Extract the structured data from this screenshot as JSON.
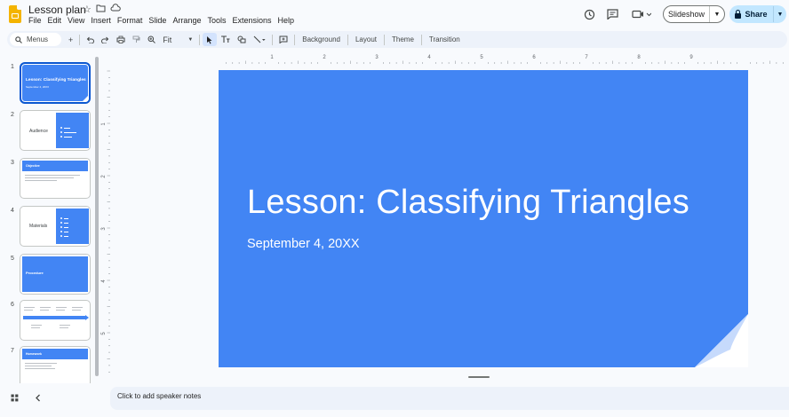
{
  "app": {
    "doc_title": "Lesson plan",
    "menu": [
      "File",
      "Edit",
      "View",
      "Insert",
      "Format",
      "Slide",
      "Arrange",
      "Tools",
      "Extensions",
      "Help"
    ],
    "slideshow_label": "Slideshow",
    "share_label": "Share"
  },
  "toolbar": {
    "search_label": "Menus",
    "zoom_label": "Fit",
    "background_label": "Background",
    "layout_label": "Layout",
    "theme_label": "Theme",
    "transition_label": "Transition"
  },
  "ruler": {
    "top_numbers": [
      "1",
      "2",
      "3",
      "4",
      "5",
      "6",
      "7",
      "8",
      "9"
    ],
    "left_numbers": [
      "1",
      "2",
      "3",
      "4",
      "5"
    ]
  },
  "filmstrip": {
    "slides": [
      {
        "num": "1",
        "title": "Lesson: Classifying Triangles",
        "subtitle": "September 4, 20XX"
      },
      {
        "num": "2",
        "title": "Audience"
      },
      {
        "num": "3",
        "title": "Objective"
      },
      {
        "num": "4",
        "title": "Materials"
      },
      {
        "num": "5",
        "title": "Procedure"
      },
      {
        "num": "6",
        "title": ""
      },
      {
        "num": "7",
        "title": "Homework"
      }
    ]
  },
  "slide": {
    "title": "Lesson: Classifying Triangles",
    "subtitle": "September 4, 20XX"
  },
  "notes": {
    "placeholder": "Click to add speaker notes"
  },
  "colors": {
    "slide_blue": "#4285f4",
    "share_bg": "#c2e7ff",
    "toolbar_bg": "#edf2fa",
    "accent": "#0b57d0"
  }
}
